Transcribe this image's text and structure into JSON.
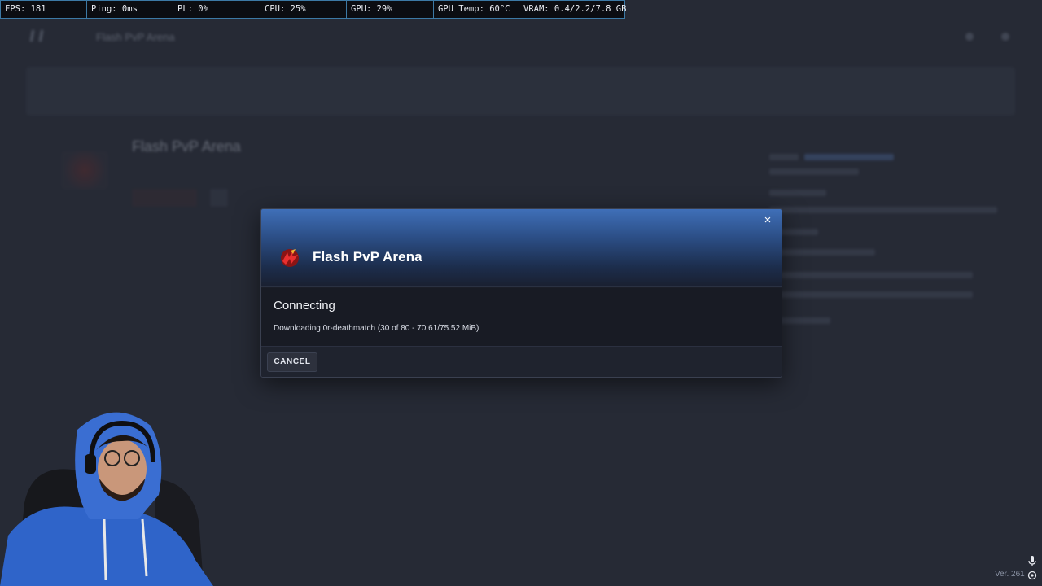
{
  "perf": {
    "fps": "FPS: 181",
    "ping": "Ping: 0ms",
    "pl": "PL: 0%",
    "cpu": "CPU: 25%",
    "gpu": "GPU: 29%",
    "gpu_temp": "GPU Temp: 60°C",
    "vram": "VRAM: 0.4/2.2/7.8 GB"
  },
  "background": {
    "app_title": "Flash PvP Arena",
    "server_name": "Flash PvP Arena"
  },
  "modal": {
    "title": "Flash PvP Arena",
    "close_glyph": "×",
    "status_title": "Connecting",
    "status_detail": "Downloading 0r-deathmatch (30 of 80 - 70.61/75.52 MiB)",
    "cancel_label": "CANCEL",
    "progress": {
      "files_done": 30,
      "files_total": 80,
      "mib_done": 70.61,
      "mib_total": 75.52
    }
  },
  "footer": {
    "version": "Ver. 261"
  },
  "icons": {
    "close": "close-icon",
    "server": "server-logo-icon",
    "mic": "microphone-icon",
    "target": "target-icon"
  },
  "colors": {
    "accent": "#3f6fb8",
    "overlay_border": "#3c79a5",
    "background": "#262a35"
  }
}
